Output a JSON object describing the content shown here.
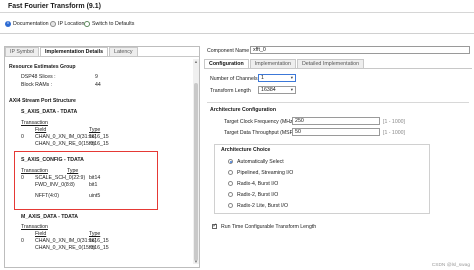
{
  "window": {
    "title": "Fast Fourier Transform (9.1)"
  },
  "toolbar": {
    "documentation": "Documentation",
    "ip_location": "IP Location",
    "switch_defaults": "Switch to Defaults"
  },
  "left": {
    "tabs": [
      "IP Symbol",
      "Implementation Details",
      "Latency"
    ],
    "resource": {
      "title": "Resource Estimates Group",
      "rows": [
        {
          "label": "DSP48 Slices :",
          "value": "9"
        },
        {
          "label": "Block RAMs :",
          "value": "44"
        }
      ]
    },
    "axi_title": "AXI4 Stream Port Structure",
    "headers": {
      "transaction": "Transaction",
      "field": "Field",
      "type": "Type"
    },
    "s_data": {
      "title": "S_AXIS_DATA - TDATA",
      "rows": [
        {
          "t": "0",
          "f": "CHAN_0_XN_IM_0(31:16)",
          "ty": "fix16_15"
        },
        {
          "t": "",
          "f": "CHAN_0_XN_RE_0(15:0)",
          "ty": "fix16_15"
        }
      ]
    },
    "s_config": {
      "title": "S_AXIS_CONFIG - TDATA",
      "rows": [
        {
          "t": "0",
          "f": "SCALE_SCH_0(22:9)",
          "ty": "bit14"
        },
        {
          "t": "",
          "f": "FWD_INV_0(8:8)",
          "ty": "bit1"
        },
        {
          "t": "",
          "f": "NFFT(4:0)",
          "ty": "uint5"
        }
      ]
    },
    "m_data": {
      "title": "M_AXIS_DATA - TDATA",
      "rows": [
        {
          "t": "0",
          "f": "CHAN_0_XN_IM_0(31:16)",
          "ty": "fix16_15"
        },
        {
          "t": "",
          "f": "CHAN_0_XN_RE_0(15:0)",
          "ty": "fix16_15"
        }
      ]
    }
  },
  "right": {
    "component_label": "Component Name",
    "component_value": "xfft_0",
    "tabs": [
      "Configuration",
      "Implementation",
      "Detailed Implementation"
    ],
    "num_channels_label": "Number of Channels",
    "num_channels_value": "1",
    "transform_length_label": "Transform Length",
    "transform_length_value": "16384",
    "arch_config_title": "Architecture Configuration",
    "clock_label": "Target Clock Frequency (MHz)",
    "clock_value": "250",
    "clock_range": "[1 - 1000]",
    "throughput_label": "Target Data Throughput (MSPS)",
    "throughput_value": "50",
    "throughput_range": "[1 - 1000]",
    "arch_choice_title": "Architecture Choice",
    "arch_options": [
      "Automatically Select",
      "Pipelined, Streaming I/O",
      "Radix-4, Burst I/O",
      "Radix-2, Burst I/O",
      "Radix-2 Lite, Burst I/O"
    ],
    "arch_selected": 0,
    "runtime_label": "Run Time Configurable Transform Length"
  },
  "watermark": "CSDN @lsl_swag"
}
